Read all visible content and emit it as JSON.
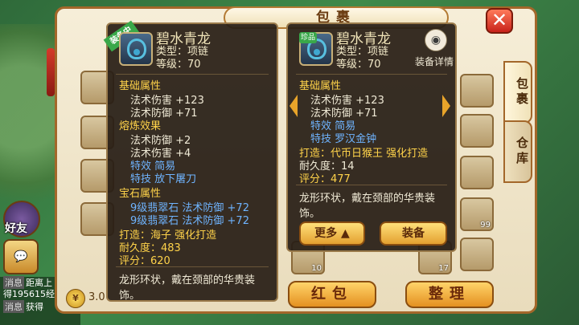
{
  "window": {
    "title": "包裹"
  },
  "side": {
    "friend_label": "好友",
    "chat": [
      {
        "tag": "消息",
        "text": "距离上"
      },
      {
        "tag": "",
        "text": "得195615经"
      },
      {
        "tag": "消息",
        "text": "获得"
      }
    ]
  },
  "tabs": [
    {
      "label": "包裹"
    },
    {
      "label": "仓库"
    }
  ],
  "currency": {
    "value": "3.0"
  },
  "buttons": {
    "red_packet": "红包",
    "organize": "整理"
  },
  "slot_counts": [
    "99",
    "10",
    "17"
  ],
  "left_panel": {
    "equipped_tag": "装备中",
    "name": "碧水青龙",
    "type": "类型：项链",
    "level": "等级：70",
    "base_title": "基础属性",
    "base_rows": [
      "法术伤害 +123",
      "法术防御 +71"
    ],
    "refine_title": "熔炼效果",
    "refine_rows": [
      "法术防御 +2",
      "法术伤害 +4"
    ],
    "special_rows": [
      "特效 简易",
      "特技 放下屠刀"
    ],
    "gem_title": "宝石属性",
    "gem_rows": [
      "9级翡翠石 法术防御 +72",
      "9级翡翠石 法术防御 +72"
    ],
    "maker": "打造：海子  强化打造",
    "durability": "耐久度：483",
    "score": "评分：620",
    "description": "龙形环状，戴在颈部的华贵装饰。"
  },
  "right_panel": {
    "prize_tag": "珍品",
    "name": "碧水青龙",
    "type": "类型：项链",
    "level": "等级：70",
    "detail_label": "装备详情",
    "base_title": "基础属性",
    "base_rows": [
      "法术伤害 +123",
      "法术防御 +71"
    ],
    "special_rows": [
      "特效 简易",
      "特技 罗汉金钟"
    ],
    "maker": "打造：代币日猴王  强化打造",
    "durability": "耐久度：14",
    "score": "评分：477",
    "description": "龙形环状，戴在颈部的华贵装饰。",
    "more_label": "更多",
    "equip_label": "装备"
  },
  "colors": {
    "window_border": "#a3672a",
    "attribute_yellow": "#ffd34a",
    "attribute_blue": "#6fb4ff"
  }
}
